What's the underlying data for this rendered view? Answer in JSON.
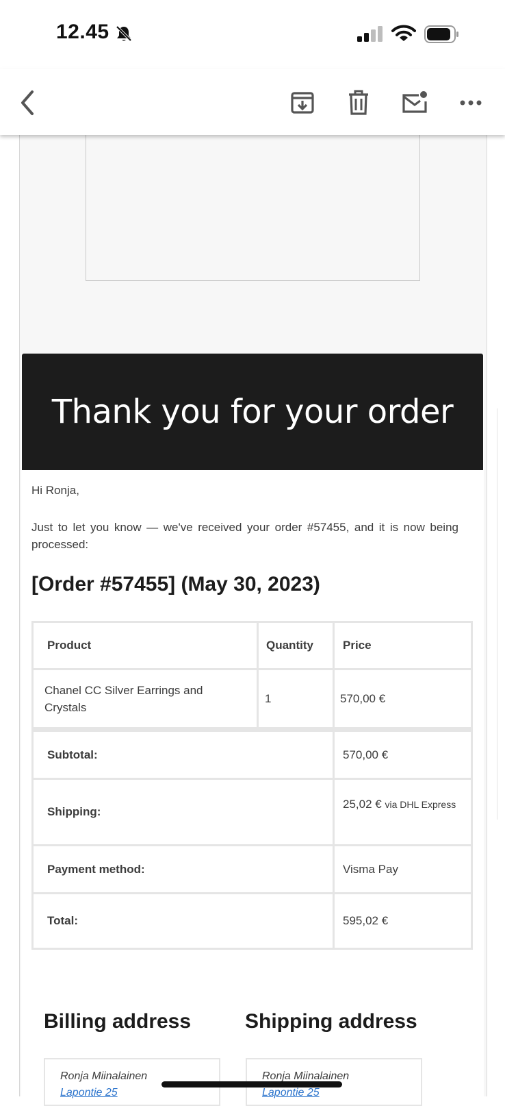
{
  "status_bar": {
    "time": "12.45",
    "icons": [
      "bell-off-icon",
      "cellular-signal-icon",
      "wifi-icon",
      "battery-icon"
    ]
  },
  "toolbar": {
    "icons": [
      "back-chevron-icon",
      "archive-icon",
      "trash-icon",
      "mark-unread-icon",
      "more-icon"
    ]
  },
  "email": {
    "header_title": "Thank you for your order",
    "greeting": "Hi Ronja,",
    "intro": "Just to let you know — we've received your order #57455, and it is now being processed:",
    "order_heading": "[Order #57455] (May 30, 2023)",
    "table": {
      "headers": [
        "Product",
        "Quantity",
        "Price"
      ],
      "item": {
        "product": "Chanel CC Silver Earrings and Crystals",
        "quantity": "1",
        "price": "570,00 €"
      },
      "subtotal": {
        "label": "Subtotal:",
        "value": "570,00 €"
      },
      "shipping": {
        "label": "Shipping:",
        "value": "25,02 €",
        "method": "via DHL Express"
      },
      "payment": {
        "label": "Payment method:",
        "value": "Visma Pay"
      },
      "total": {
        "label": "Total:",
        "value": "595,02 €"
      }
    },
    "billing": {
      "heading": "Billing address",
      "name": "Ronja Miinalainen",
      "street": "Lapontie 25"
    },
    "shipping_address": {
      "heading": "Shipping address",
      "name": "Ronja Miinalainen",
      "street": "Lapontie 25"
    }
  },
  "colors": {
    "banner": "#1c1c1c",
    "link": "#2a73cc",
    "table_border": "#e5e5e5"
  }
}
